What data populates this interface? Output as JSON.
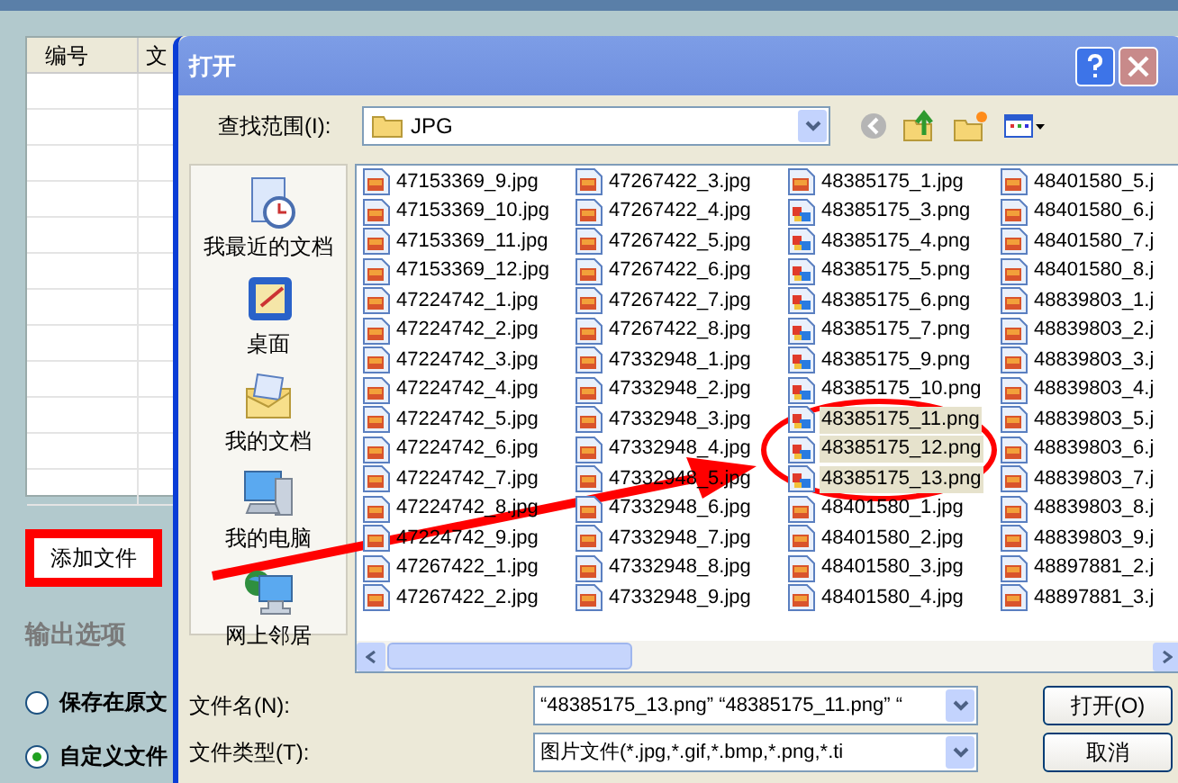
{
  "background_app": {
    "table": {
      "columns": [
        "编号",
        "文"
      ]
    },
    "add_button": "添加文件",
    "output_options": {
      "title": "输出选项",
      "options": [
        {
          "label": "保存在原文",
          "selected": false
        },
        {
          "label": "自定义文件",
          "selected": true
        }
      ]
    }
  },
  "dialog": {
    "title": "打开",
    "look_in": {
      "label": "查找范围(I):",
      "value": "JPG"
    },
    "places": [
      {
        "label": "我最近的文档",
        "kind": "recent"
      },
      {
        "label": "桌面",
        "kind": "desktop"
      },
      {
        "label": "我的文档",
        "kind": "documents"
      },
      {
        "label": "我的电脑",
        "kind": "computer"
      },
      {
        "label": "网上邻居",
        "kind": "network"
      }
    ],
    "files": [
      {
        "name": "47153369_9.jpg",
        "kind": "jpg",
        "selected": false
      },
      {
        "name": "47153369_10.jpg",
        "kind": "jpg",
        "selected": false
      },
      {
        "name": "47153369_11.jpg",
        "kind": "jpg",
        "selected": false
      },
      {
        "name": "47153369_12.jpg",
        "kind": "jpg",
        "selected": false
      },
      {
        "name": "47224742_1.jpg",
        "kind": "jpg",
        "selected": false
      },
      {
        "name": "47224742_2.jpg",
        "kind": "jpg",
        "selected": false
      },
      {
        "name": "47224742_3.jpg",
        "kind": "jpg",
        "selected": false
      },
      {
        "name": "47224742_4.jpg",
        "kind": "jpg",
        "selected": false
      },
      {
        "name": "47224742_5.jpg",
        "kind": "jpg",
        "selected": false
      },
      {
        "name": "47224742_6.jpg",
        "kind": "jpg",
        "selected": false
      },
      {
        "name": "47224742_7.jpg",
        "kind": "jpg",
        "selected": false
      },
      {
        "name": "47224742_8.jpg",
        "kind": "jpg",
        "selected": false
      },
      {
        "name": "47224742_9.jpg",
        "kind": "jpg",
        "selected": false
      },
      {
        "name": "47267422_1.jpg",
        "kind": "jpg",
        "selected": false
      },
      {
        "name": "47267422_2.jpg",
        "kind": "jpg",
        "selected": false
      },
      {
        "name": "47267422_3.jpg",
        "kind": "jpg",
        "selected": false
      },
      {
        "name": "47267422_4.jpg",
        "kind": "jpg",
        "selected": false
      },
      {
        "name": "47267422_5.jpg",
        "kind": "jpg",
        "selected": false
      },
      {
        "name": "47267422_6.jpg",
        "kind": "jpg",
        "selected": false
      },
      {
        "name": "47267422_7.jpg",
        "kind": "jpg",
        "selected": false
      },
      {
        "name": "47267422_8.jpg",
        "kind": "jpg",
        "selected": false
      },
      {
        "name": "47332948_1.jpg",
        "kind": "jpg",
        "selected": false
      },
      {
        "name": "47332948_2.jpg",
        "kind": "jpg",
        "selected": false
      },
      {
        "name": "47332948_3.jpg",
        "kind": "jpg",
        "selected": false
      },
      {
        "name": "47332948_4.jpg",
        "kind": "jpg",
        "selected": false
      },
      {
        "name": "47332948_5.jpg",
        "kind": "jpg",
        "selected": false
      },
      {
        "name": "47332948_6.jpg",
        "kind": "jpg",
        "selected": false
      },
      {
        "name": "47332948_7.jpg",
        "kind": "jpg",
        "selected": false
      },
      {
        "name": "47332948_8.jpg",
        "kind": "jpg",
        "selected": false
      },
      {
        "name": "47332948_9.jpg",
        "kind": "jpg",
        "selected": false
      },
      {
        "name": "48385175_1.jpg",
        "kind": "jpg",
        "selected": false
      },
      {
        "name": "48385175_3.png",
        "kind": "png",
        "selected": false
      },
      {
        "name": "48385175_4.png",
        "kind": "png",
        "selected": false
      },
      {
        "name": "48385175_5.png",
        "kind": "png",
        "selected": false
      },
      {
        "name": "48385175_6.png",
        "kind": "png",
        "selected": false
      },
      {
        "name": "48385175_7.png",
        "kind": "png",
        "selected": false
      },
      {
        "name": "48385175_9.png",
        "kind": "png",
        "selected": false
      },
      {
        "name": "48385175_10.png",
        "kind": "png",
        "selected": false
      },
      {
        "name": "48385175_11.png",
        "kind": "png",
        "selected": true
      },
      {
        "name": "48385175_12.png",
        "kind": "png",
        "selected": true
      },
      {
        "name": "48385175_13.png",
        "kind": "png",
        "selected": true
      },
      {
        "name": "48401580_1.jpg",
        "kind": "jpg",
        "selected": false
      },
      {
        "name": "48401580_2.jpg",
        "kind": "jpg",
        "selected": false
      },
      {
        "name": "48401580_3.jpg",
        "kind": "jpg",
        "selected": false
      },
      {
        "name": "48401580_4.jpg",
        "kind": "jpg",
        "selected": false
      },
      {
        "name": "48401580_5.j",
        "kind": "jpg",
        "selected": false
      },
      {
        "name": "48401580_6.j",
        "kind": "jpg",
        "selected": false
      },
      {
        "name": "48401580_7.j",
        "kind": "jpg",
        "selected": false
      },
      {
        "name": "48401580_8.j",
        "kind": "jpg",
        "selected": false
      },
      {
        "name": "48839803_1.j",
        "kind": "jpg",
        "selected": false
      },
      {
        "name": "48839803_2.j",
        "kind": "jpg",
        "selected": false
      },
      {
        "name": "48839803_3.j",
        "kind": "jpg",
        "selected": false
      },
      {
        "name": "48839803_4.j",
        "kind": "jpg",
        "selected": false
      },
      {
        "name": "48839803_5.j",
        "kind": "jpg",
        "selected": false
      },
      {
        "name": "48839803_6.j",
        "kind": "jpg",
        "selected": false
      },
      {
        "name": "48839803_7.j",
        "kind": "jpg",
        "selected": false
      },
      {
        "name": "48839803_8.j",
        "kind": "jpg",
        "selected": false
      },
      {
        "name": "48839803_9.j",
        "kind": "jpg",
        "selected": false
      },
      {
        "name": "48897881_2.j",
        "kind": "jpg",
        "selected": false
      },
      {
        "name": "48897881_3.j",
        "kind": "jpg",
        "selected": false
      }
    ],
    "file_name": {
      "label": "文件名(N):",
      "value": "“48385175_13.png” “48385175_11.png” “"
    },
    "file_type": {
      "label": "文件类型(T):",
      "value": "图片文件(*.jpg,*.gif,*.bmp,*.png,*.ti"
    },
    "buttons": [
      "打开(O)",
      "取消"
    ]
  }
}
